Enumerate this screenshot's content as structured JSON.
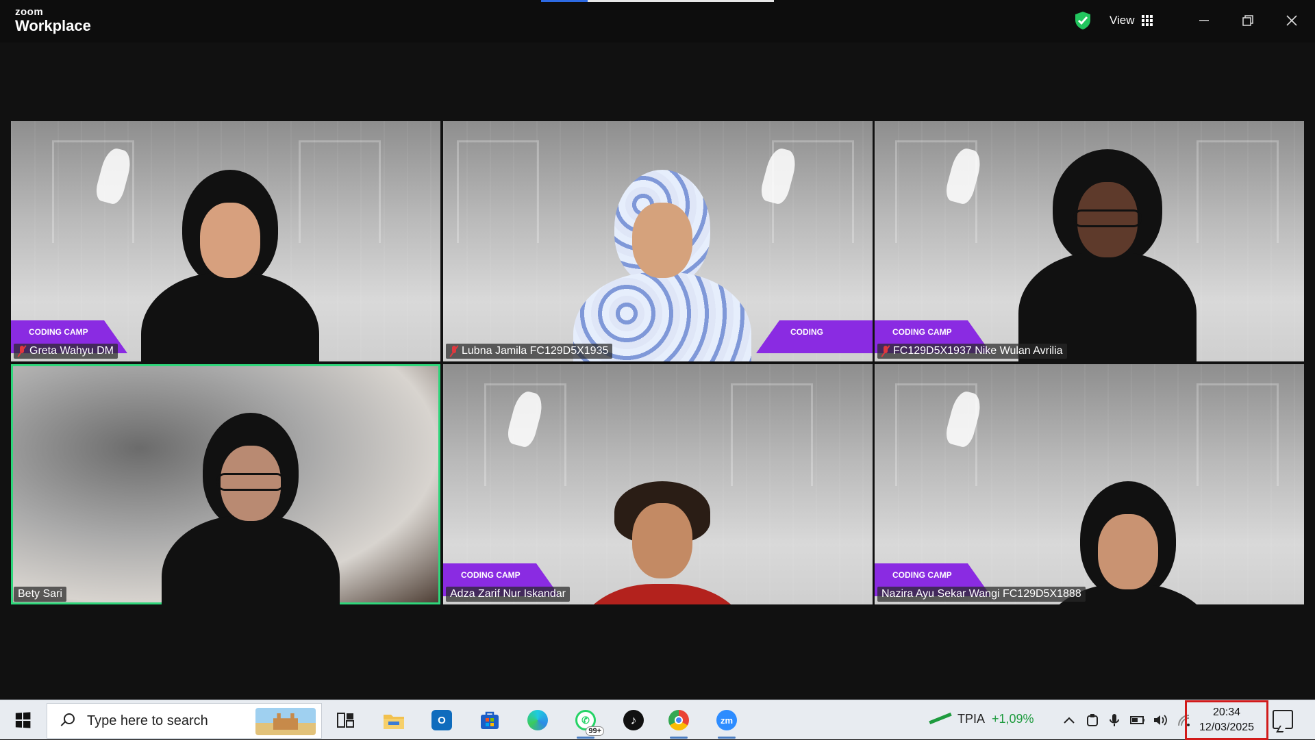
{
  "app": {
    "brand_small": "zoom",
    "brand_big": "Workplace",
    "view_label": "View"
  },
  "participants": [
    {
      "name": "Greta Wahyu DM",
      "muted": true,
      "banner": "CODING CAMP"
    },
    {
      "name": "Lubna Jamila FC129D5X1935",
      "muted": true,
      "banner": "CODING"
    },
    {
      "name": "FC129D5X1937 Nike Wulan Avrilia",
      "muted": true,
      "banner": "CODING CAMP"
    },
    {
      "name": "Bety Sari",
      "muted": false,
      "active_speaker": true
    },
    {
      "name": "Adza Zarif Nur Iskandar",
      "muted": false,
      "banner": "CODING CAMP"
    },
    {
      "name": "Nazira Ayu Sekar Wangi FC129D5X1888",
      "muted": false,
      "banner": "CODING CAMP"
    }
  ],
  "taskbar": {
    "search_placeholder": "Type here to search",
    "apps": [
      "task-view",
      "file-explorer",
      "outlook",
      "microsoft-store",
      "edge",
      "whatsapp",
      "tiktok",
      "chrome",
      "zoom"
    ],
    "whatsapp_badge": "99+",
    "zoom_label": "zm",
    "ticker": {
      "name": "TPIA",
      "change": "+1,09%"
    },
    "clock": {
      "time": "20:34",
      "date": "12/03/2025"
    }
  },
  "colors": {
    "active_speaker_border": "#2fd67b",
    "shield_green": "#22c55e",
    "ticker_green": "#1e9b3e",
    "clock_highlight": "#d11a1a"
  }
}
